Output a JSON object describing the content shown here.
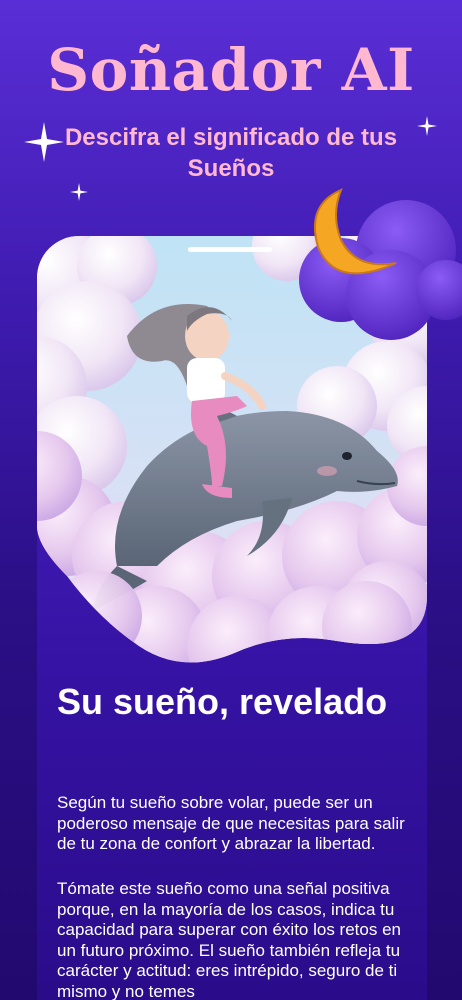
{
  "app": {
    "title": "Soñador AI",
    "tagline": "Descifra el significado de tus Sueños"
  },
  "icons": [
    "sparkle-icon",
    "moon-icon",
    "cloud-icon"
  ],
  "colors": {
    "accent_pink": "#ffb8cf",
    "background_top": "#5a2ed6",
    "background_bottom": "#22096f",
    "moon": "#f5a623",
    "cloud": "#6a3ae0"
  },
  "content": {
    "heading": "Su sueño, revelado",
    "paragraph_1": "Según tu sueño sobre volar, puede ser un poderoso mensaje de que necesitas para salir de tu zona de confort y abrazar la libertad.",
    "paragraph_2": "Tómate este sueño como una señal positiva porque, en la mayoría de los casos, indica tu capacidad para superar con éxito los retos en un futuro próximo. El sueño también refleja tu carácter y actitud: eres intrépido, seguro de ti mismo y no temes"
  }
}
